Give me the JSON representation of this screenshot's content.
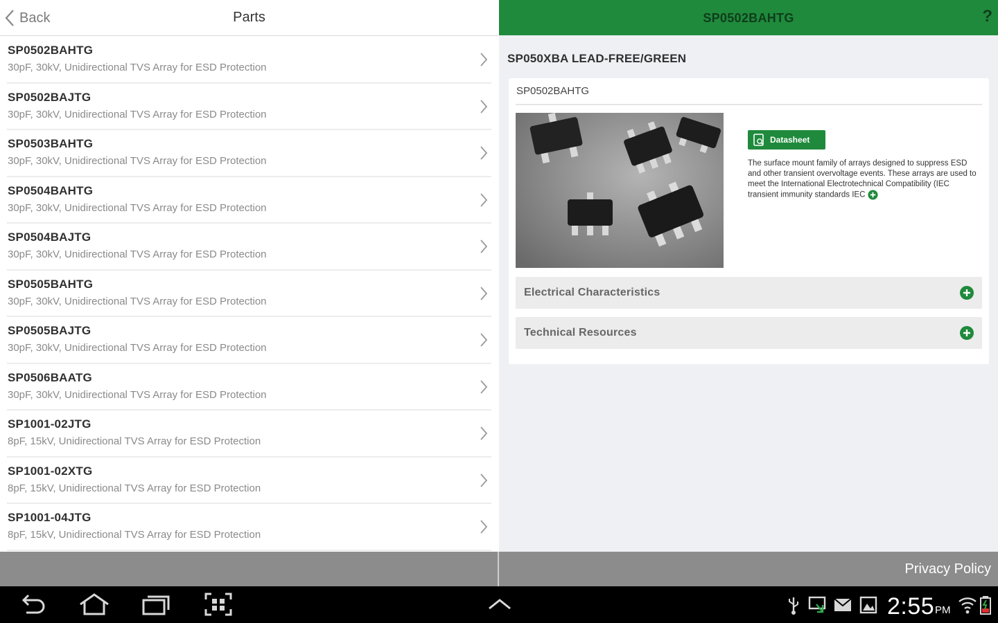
{
  "left_header": {
    "back_label": "Back",
    "title": "Parts"
  },
  "parts": [
    {
      "name": "SP0502BAHTG",
      "desc": "30pF, 30kV, Unidirectional TVS Array for ESD Protection"
    },
    {
      "name": "SP0502BAJTG",
      "desc": "30pF, 30kV, Unidirectional TVS Array for ESD Protection"
    },
    {
      "name": "SP0503BAHTG",
      "desc": "30pF, 30kV, Unidirectional TVS Array for ESD Protection"
    },
    {
      "name": "SP0504BAHTG",
      "desc": "30pF, 30kV, Unidirectional TVS Array for ESD Protection"
    },
    {
      "name": "SP0504BAJTG",
      "desc": "30pF, 30kV, Unidirectional TVS Array for ESD Protection"
    },
    {
      "name": "SP0505BAHTG",
      "desc": "30pF, 30kV, Unidirectional TVS Array for ESD Protection"
    },
    {
      "name": "SP0505BAJTG",
      "desc": "30pF, 30kV, Unidirectional TVS Array for ESD Protection"
    },
    {
      "name": "SP0506BAATG",
      "desc": "30pF, 30kV, Unidirectional TVS Array for ESD Protection"
    },
    {
      "name": "SP1001-02JTG",
      "desc": "8pF, 15kV, Unidirectional TVS Array for ESD Protection"
    },
    {
      "name": "SP1001-02XTG",
      "desc": "8pF, 15kV, Unidirectional TVS Array for ESD Protection"
    },
    {
      "name": "SP1001-04JTG",
      "desc": "8pF, 15kV, Unidirectional TVS Array for ESD Protection"
    }
  ],
  "right_header": {
    "title": "SP0502BAHTG",
    "help_label": "?"
  },
  "detail": {
    "family": "SP050XBA LEAD-FREE/GREEN",
    "part_number": "SP0502BAHTG",
    "datasheet_label": "Datasheet",
    "description": "The surface mount family of arrays designed to suppress ESD and other transient overvoltage events. These arrays are used to meet the International Electrotechnical Compatibility (IEC transient immunity standards IEC",
    "sections": [
      {
        "label": "Electrical Characteristics"
      },
      {
        "label": "Technical Resources"
      }
    ]
  },
  "footer": {
    "privacy_label": "Privacy Policy"
  },
  "status": {
    "time": "2:55",
    "ampm": "PM"
  },
  "colors": {
    "brand_green": "#1f8a3c",
    "footer_gray": "#8c8c8c",
    "nav_black": "#000000"
  }
}
